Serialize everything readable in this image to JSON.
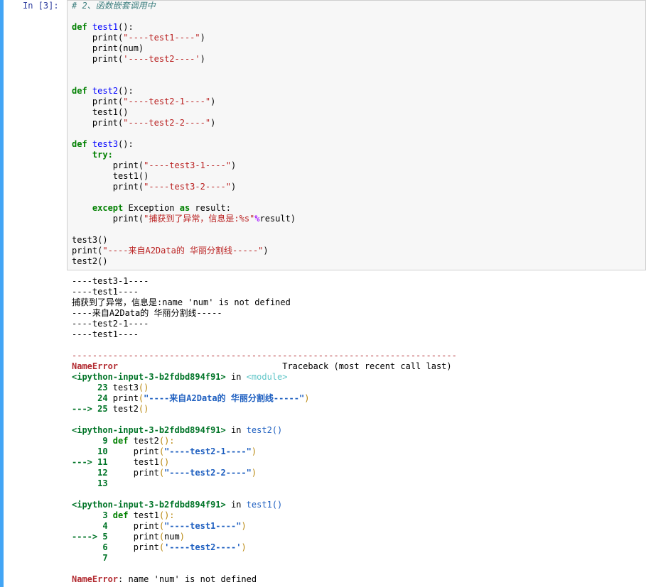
{
  "cell": {
    "prompt": "In  [3]:",
    "comment": "# 2、函数嵌套调用中",
    "lines": {
      "def_test1": "def test1():",
      "t1_p1": "print(\"----test1----\")",
      "t1_p2": "print(num)",
      "t1_p3": "print('----test2----')",
      "def_test2": "def test2():",
      "t2_p1": "print(\"----test2-1----\")",
      "t2_call": "test1()",
      "t2_p2": "print(\"----test2-2----\")",
      "def_test3": "def test3():",
      "try_kw": "try:",
      "t3_p1": "print(\"----test3-1----\")",
      "t3_call": "test1()",
      "t3_p2": "print(\"----test3-2----\")",
      "except_line": "except Exception as result:",
      "except_print": "print(\"捕获到了异常，信息是:%s\"%result)",
      "call3": "test3()",
      "print_sep": "print(\"----来自A2Data的 华丽分割线-----\")",
      "call2": "test2()"
    }
  },
  "output": {
    "stdout": [
      "----test3-1----",
      "----test1----",
      "捕获到了异常，信息是:name 'num' is not defined",
      "----来自A2Data的 华丽分割线-----",
      "----test2-1----",
      "----test1----"
    ],
    "traceback": {
      "divider": "---------------------------------------------------------------------------",
      "error_name": "NameError",
      "header_right": "Traceback (most recent call last)",
      "frames": [
        {
          "location": "<ipython-input-3-b2fdbd894f91>",
          "in_word": "in",
          "func": "<module>",
          "lines": [
            "     23 test3()",
            "     24 print(\"----来自A2Data的 华丽分割线-----\")",
            "---> 25 test2()"
          ]
        },
        {
          "location": "<ipython-input-3-b2fdbd894f91>",
          "in_word": "in",
          "func": "test2()",
          "lines": [
            "      9 def test2():",
            "     10     print(\"----test2-1----\")",
            "---> 11     test1()",
            "     12     print(\"----test2-2----\")",
            "     13"
          ]
        },
        {
          "location": "<ipython-input-3-b2fdbd894f91>",
          "in_word": "in",
          "func": "test1()",
          "lines": [
            "      3 def test1():",
            "      4     print(\"----test1----\")",
            "----> 5     print(num)",
            "      6     print('----test2----')",
            "      7"
          ]
        }
      ],
      "final_error_name": "NameError",
      "final_message": ": name 'num' is not defined"
    }
  },
  "colors": {
    "accent_bar": "#42a5f5",
    "prompt": "#303f9f",
    "keyword": "#008000",
    "function_name": "#0000ff",
    "string": "#ba2121",
    "error": "#b22b31"
  }
}
